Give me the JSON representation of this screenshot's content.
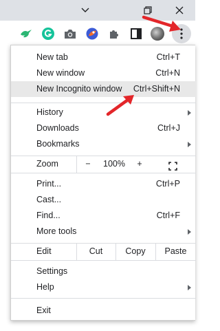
{
  "colors": {
    "titlebar_bg": "#dee1e6",
    "menu_highlight": "#e8e8e8",
    "annotation_arrow": "#e3262a",
    "extension_green": "#2bb673",
    "grammarly_green": "#15c39a"
  },
  "window_controls": {
    "icons": [
      "chevron-down-icon",
      "restore-icon",
      "close-icon"
    ]
  },
  "toolbar": {
    "icons": [
      "bird-extension-icon",
      "grammarly-icon",
      "camera-icon",
      "sphere-extension-icon",
      "puzzle-icon",
      "side-panel-icon",
      "profile-avatar",
      "kebab-menu-icon"
    ]
  },
  "menu": {
    "group1": [
      {
        "label": "New tab",
        "shortcut": "Ctrl+T"
      },
      {
        "label": "New window",
        "shortcut": "Ctrl+N"
      },
      {
        "label": "New Incognito window",
        "shortcut": "Ctrl+Shift+N",
        "highlighted": true
      }
    ],
    "group2": [
      {
        "label": "History",
        "submenu": true
      },
      {
        "label": "Downloads",
        "shortcut": "Ctrl+J"
      },
      {
        "label": "Bookmarks",
        "submenu": true
      }
    ],
    "zoom": {
      "label": "Zoom",
      "minus": "−",
      "value": "100%",
      "plus": "+",
      "fullscreen_icon": "fullscreen-icon"
    },
    "group3": [
      {
        "label": "Print...",
        "shortcut": "Ctrl+P"
      },
      {
        "label": "Cast..."
      },
      {
        "label": "Find...",
        "shortcut": "Ctrl+F"
      },
      {
        "label": "More tools",
        "submenu": true
      }
    ],
    "edit": {
      "label": "Edit",
      "cut": "Cut",
      "copy": "Copy",
      "paste": "Paste"
    },
    "group4": [
      {
        "label": "Settings"
      },
      {
        "label": "Help",
        "submenu": true
      }
    ],
    "group5": [
      {
        "label": "Exit"
      }
    ]
  }
}
